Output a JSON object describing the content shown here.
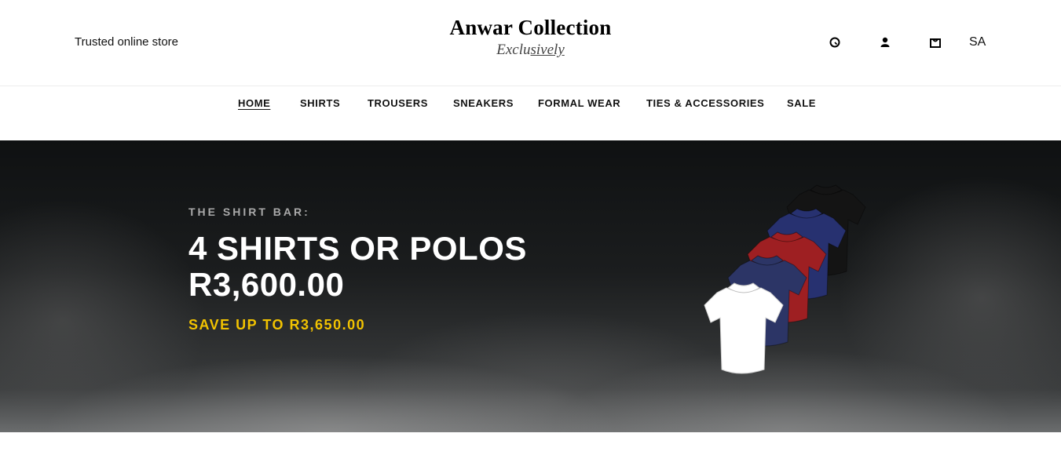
{
  "header": {
    "tagline": "Trusted online store",
    "brand_name": "Anwar Collection",
    "brand_sub_prefix": "Exclu",
    "brand_sub_underlined": "sively",
    "currency": "SA",
    "icons": [
      "search-icon",
      "account-icon",
      "cart-icon"
    ]
  },
  "nav": {
    "home": "HOME",
    "shirts": "SHIRTS",
    "trousers": "TROUSERS",
    "sneakers": "SNEAKERS",
    "formal": "FORMAL WEAR",
    "ties": "TIES & ACCESSORIES",
    "sale": "SALE"
  },
  "hero": {
    "kicker": "THE SHIRT BAR:",
    "title": "4 SHIRTS OR POLOS",
    "price": "R3,600.00",
    "save": "SAVE UP TO R3,650.00",
    "accent_color": "#f2c300",
    "shirt_colors": [
      "#ffffff",
      "#2c3566",
      "#9e1f22",
      "#273170",
      "#141414"
    ]
  }
}
